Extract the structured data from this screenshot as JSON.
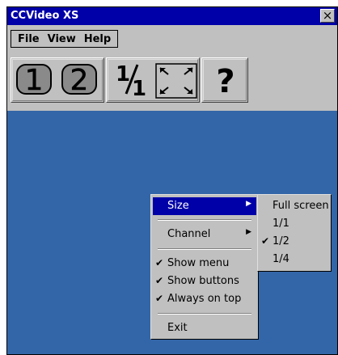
{
  "window": {
    "title": "CCVideo XS",
    "close_label": "×"
  },
  "menubar": {
    "items": [
      {
        "label": "File"
      },
      {
        "label": "View"
      },
      {
        "label": "Help"
      }
    ]
  },
  "toolbar": {
    "buttons": [
      {
        "label": "1",
        "icon": "channel-1-icon"
      },
      {
        "label": "2",
        "icon": "channel-2-icon"
      },
      {
        "label": "1/1",
        "icon": "size-one-to-one-icon"
      },
      {
        "icon": "fullscreen-icon"
      },
      {
        "label": "?",
        "icon": "help-icon"
      }
    ]
  },
  "context_menu": {
    "items": [
      {
        "label": "Size",
        "submenu": true,
        "checked": false,
        "highlighted": true
      },
      {
        "label": "Channel",
        "submenu": true,
        "checked": false
      },
      {
        "label": "Show menu",
        "checked": true
      },
      {
        "label": "Show buttons",
        "checked": true
      },
      {
        "label": "Always on top",
        "checked": true
      },
      {
        "label": "Exit",
        "checked": false
      }
    ],
    "check_glyph": "✔",
    "submenu_arrow": "▶"
  },
  "size_submenu": {
    "items": [
      {
        "label": "Full screen",
        "checked": false
      },
      {
        "label": "1/1",
        "checked": false
      },
      {
        "label": "1/2",
        "checked": true
      },
      {
        "label": "1/4",
        "checked": false
      }
    ]
  },
  "colors": {
    "titlebar": "#0000a8",
    "canvas": "#3366a8",
    "chrome": "#c0c0c0",
    "highlight": "#0000a8"
  }
}
